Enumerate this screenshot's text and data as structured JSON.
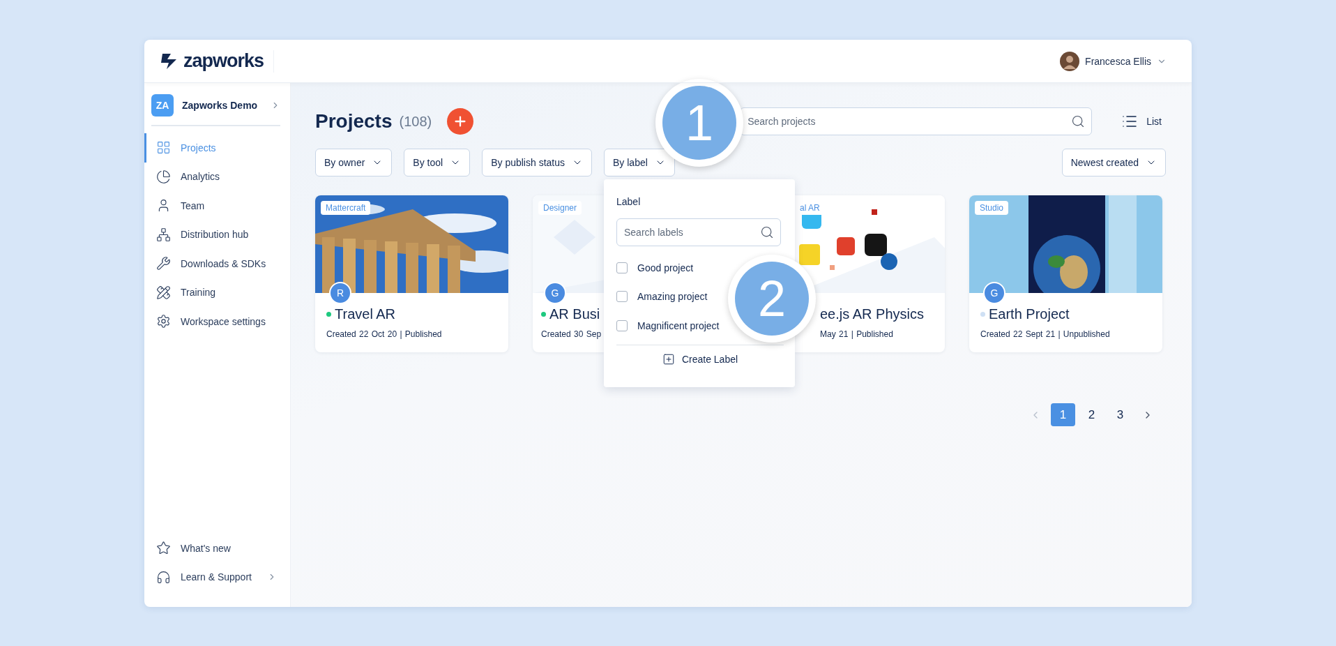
{
  "header": {
    "logo": "zapworks",
    "user": "Francesca Ellis"
  },
  "sidebar": {
    "workspace": {
      "initials": "ZA",
      "name": "Zapworks Demo"
    },
    "items": [
      {
        "label": "Projects",
        "selected": true
      },
      {
        "label": "Analytics",
        "selected": false
      },
      {
        "label": "Team",
        "selected": false
      },
      {
        "label": "Distribution hub",
        "selected": false
      },
      {
        "label": "Downloads & SDKs",
        "selected": false
      },
      {
        "label": "Training",
        "selected": false
      },
      {
        "label": "Workspace settings",
        "selected": false
      }
    ],
    "bottom_items": [
      {
        "label": "What's new"
      },
      {
        "label": "Learn & Support"
      }
    ]
  },
  "page": {
    "title": "Projects",
    "count": "(108)",
    "search_placeholder": "Search projects",
    "view_label": "List",
    "filters": [
      "By owner",
      "By tool",
      "By publish status",
      "By label"
    ],
    "sort": "Newest created"
  },
  "label_menu": {
    "title": "Label",
    "search_placeholder": "Search labels",
    "options": [
      {
        "label": "Good project",
        "checked": false
      },
      {
        "label": "Amazing project",
        "checked": false
      },
      {
        "label": "Magnificent project",
        "checked": false
      }
    ],
    "create": "Create Label"
  },
  "cards": [
    {
      "kind": "full",
      "tag": "Mattercraft",
      "avatar": "R",
      "title": "Travel AR",
      "meta": "Created 22 Oct 20 | Published",
      "color": "#1ec97f"
    },
    {
      "kind": "cut_right",
      "tag": "Designer",
      "avatar": "G",
      "title": "AR Busi",
      "meta": "Created 30 Sep",
      "color": "#1ec97f"
    },
    {
      "kind": "cut_left",
      "tag": "al AR",
      "title": "ee.js AR Physics",
      "meta": "May 21 | Published"
    },
    {
      "kind": "full",
      "tag": "Studio",
      "avatar": "G",
      "title": "Earth Project",
      "meta": "Created 22 Sept 21 | Unpublished",
      "color": "#cfe0f4"
    }
  ],
  "pagination": {
    "pages": [
      {
        "label": "1",
        "selected": true
      },
      {
        "label": "2",
        "selected": false
      },
      {
        "label": "3",
        "selected": false
      }
    ]
  },
  "callouts": [
    "1",
    "2"
  ]
}
